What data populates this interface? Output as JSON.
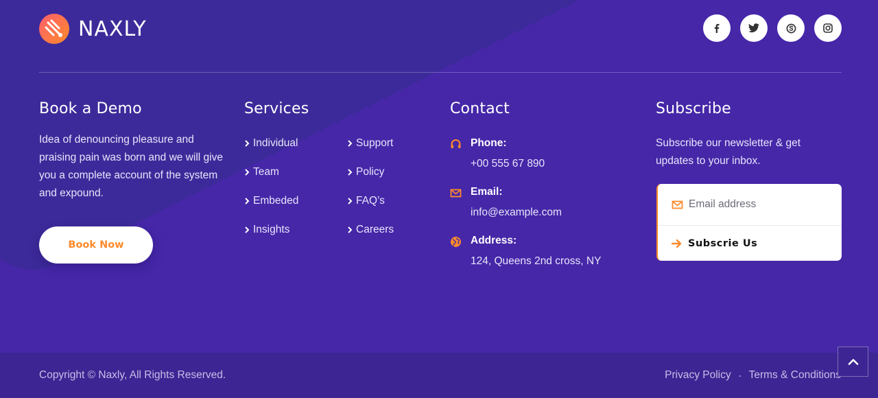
{
  "brand": {
    "name": "NAXLY",
    "accent": "#ff8a2b",
    "background": "#4527a8"
  },
  "socials": [
    {
      "icon": "facebook-icon"
    },
    {
      "icon": "twitter-icon"
    },
    {
      "icon": "skype-icon"
    },
    {
      "icon": "instagram-icon"
    }
  ],
  "demo": {
    "heading": "Book a Demo",
    "text": "Idea of denouncing pleasure and praising pain was born and we will give you a complete account of the system and expound.",
    "button": "Book Now"
  },
  "services": {
    "heading": "Services",
    "left": [
      "Individual",
      "Team",
      "Embeded",
      "Insights"
    ],
    "right": [
      "Support",
      "Policy",
      "FAQ’s",
      "Careers"
    ]
  },
  "contact": {
    "heading": "Contact",
    "phone_label": "Phone:",
    "phone": "+00 555 67 890",
    "email_label": "Email:",
    "email": "info@example.com",
    "address_label": "Address:",
    "address": "124, Queens 2nd cross, NY"
  },
  "subscribe": {
    "heading": "Subscribe",
    "text": "Subscribe our newsletter & get updates to your inbox.",
    "placeholder": "Email address",
    "button": "Subscrie Us"
  },
  "footer": {
    "copyright": "Copyright © Naxly, All Rights Reserved.",
    "privacy": "Privacy Policy",
    "separator": "-",
    "terms": "Terms & Conditions"
  }
}
